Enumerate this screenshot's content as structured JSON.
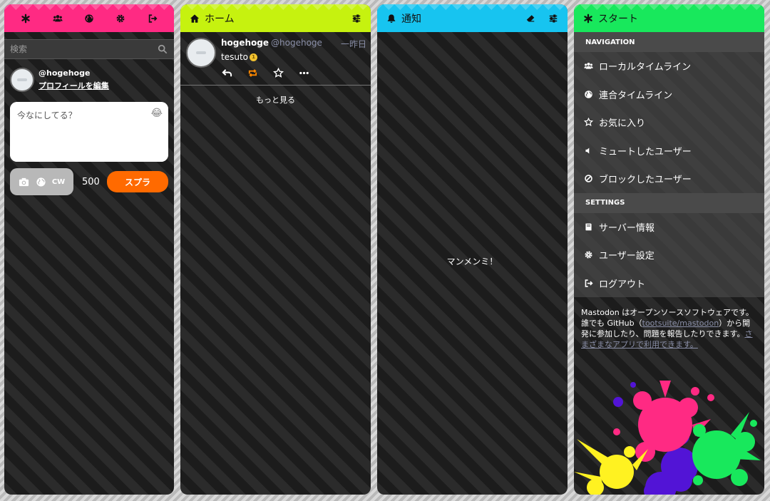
{
  "compose_column": {
    "header_icons": [
      "asterisk-icon",
      "users-icon",
      "globe-icon",
      "gear-icon",
      "sign-out-icon"
    ],
    "search": {
      "placeholder": "検索"
    },
    "profile": {
      "acct": "@hogehoge",
      "edit_link": "プロフィールを編集"
    },
    "compose": {
      "placeholder": "今なにしてる？",
      "cw_label": "CW",
      "char_count": "500",
      "submit_label": "スプラ"
    }
  },
  "home_column": {
    "title": "ホーム",
    "status": {
      "display_name": "hogehoge",
      "acct": "@hogehoge",
      "time": "一昨日",
      "text": "tesuto",
      "emoji_badge": "1"
    },
    "load_more": "もっと見る"
  },
  "notifications_column": {
    "title": "通知",
    "empty_message": "マンメンミ！"
  },
  "start_column": {
    "title": "スタート",
    "navigation_heading": "NAVIGATION",
    "navigation_items": [
      {
        "label": "ローカルタイムライン",
        "icon": "users-icon"
      },
      {
        "label": "連合タイムライン",
        "icon": "globe-icon"
      },
      {
        "label": "お気に入り",
        "icon": "star-icon"
      },
      {
        "label": "ミュートしたユーザー",
        "icon": "volume-off-icon"
      },
      {
        "label": "ブロックしたユーザー",
        "icon": "ban-icon"
      }
    ],
    "settings_heading": "SETTINGS",
    "settings_items": [
      {
        "label": "サーバー情報",
        "icon": "book-icon"
      },
      {
        "label": "ユーザー設定",
        "icon": "gear-icon"
      },
      {
        "label": "ログアウト",
        "icon": "sign-out-icon"
      }
    ],
    "about": {
      "text_1": "Mastodon はオープンソースソフトウェアです。誰でも GitHub（",
      "link_1": "tootsuite/mastodon",
      "text_2": "）から開発に参加したり、問題を報告したりできます。",
      "link_2": "さまざまなアプリで利用できます。"
    }
  },
  "colors": {
    "compose_header": "#ff2a83",
    "home_header": "#c6f20f",
    "notifications_header": "#17c4f0",
    "start_header": "#18e85c",
    "toot_button": "#ff6a00",
    "boost_active": "#ff8800"
  }
}
